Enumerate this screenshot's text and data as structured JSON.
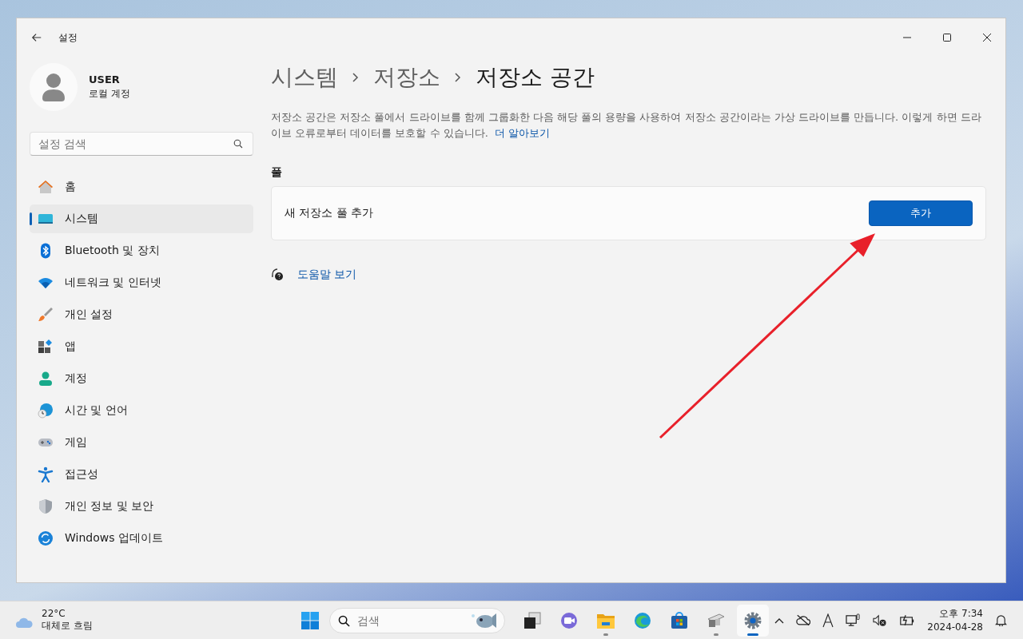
{
  "window": {
    "title": "설정"
  },
  "user": {
    "name": "USER",
    "account": "로컬 계정"
  },
  "search": {
    "placeholder": "설정 검색"
  },
  "nav": [
    {
      "label": "홈",
      "kind": "home",
      "selected": false
    },
    {
      "label": "시스템",
      "kind": "system",
      "selected": true
    },
    {
      "label": "Bluetooth 및 장치",
      "kind": "bluetooth",
      "selected": false
    },
    {
      "label": "네트워크 및 인터넷",
      "kind": "network",
      "selected": false
    },
    {
      "label": "개인 설정",
      "kind": "brush",
      "selected": false
    },
    {
      "label": "앱",
      "kind": "apps",
      "selected": false
    },
    {
      "label": "계정",
      "kind": "account",
      "selected": false
    },
    {
      "label": "시간 및 언어",
      "kind": "time",
      "selected": false
    },
    {
      "label": "게임",
      "kind": "game",
      "selected": false
    },
    {
      "label": "접근성",
      "kind": "access",
      "selected": false
    },
    {
      "label": "개인 정보 및 보안",
      "kind": "shield",
      "selected": false
    },
    {
      "label": "Windows 업데이트",
      "kind": "update",
      "selected": false
    }
  ],
  "breadcrumb": [
    "시스템",
    "저장소",
    "저장소 공간"
  ],
  "description": "저장소 공간은 저장소 풀에서 드라이브를 함께 그룹화한 다음 해당 풀의 용량을 사용하여 저장소 공간이라는 가상 드라이브를 만듭니다. 이렇게 하면 드라이브 오류로부터 데이터를 보호할 수 있습니다.",
  "learn_more": "더 알아보기",
  "section": "풀",
  "pool_card": {
    "label": "새 저장소 풀 추가",
    "button": "추가"
  },
  "help_link": "도움말 보기",
  "taskbar": {
    "weather": {
      "temp": "22°C",
      "condition": "대체로 흐림"
    },
    "search_placeholder": "검색",
    "apps": [
      {
        "kind": "taskview",
        "running": false,
        "selected": false
      },
      {
        "kind": "meet",
        "running": false,
        "selected": false
      },
      {
        "kind": "folder",
        "running": true,
        "selected": false
      },
      {
        "kind": "edge",
        "running": false,
        "selected": false
      },
      {
        "kind": "store",
        "running": false,
        "selected": false
      },
      {
        "kind": "tool",
        "running": true,
        "selected": false
      },
      {
        "kind": "settings",
        "running": true,
        "selected": true
      }
    ],
    "time": "오후 7:34",
    "date": "2024-04-28"
  }
}
